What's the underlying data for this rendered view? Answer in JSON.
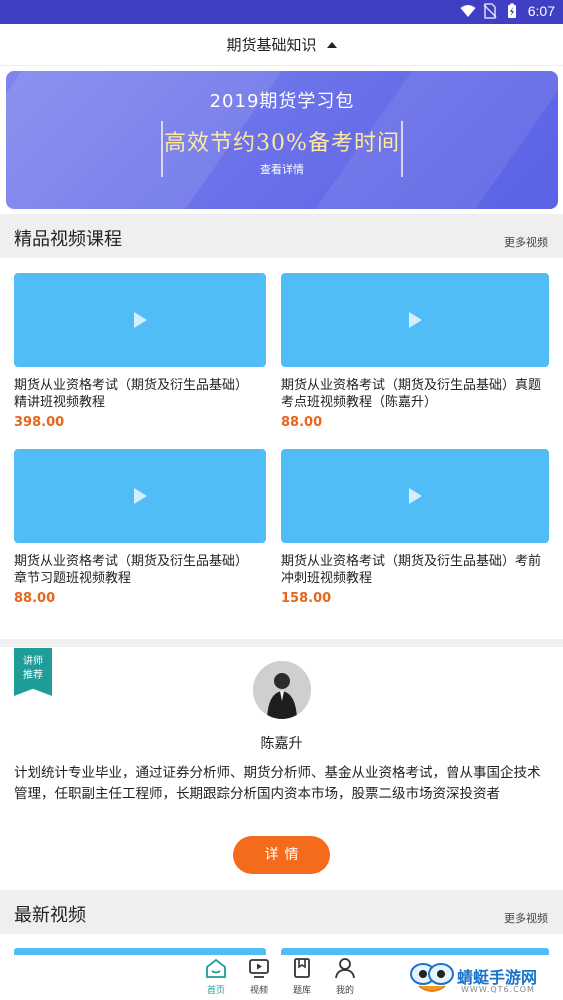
{
  "status_bar": {
    "time": "6:07",
    "icons": [
      "wifi-icon",
      "no-sim-icon",
      "battery-icon"
    ]
  },
  "header": {
    "title": "期货基础知识",
    "dropdown_icon": "caret-up-icon"
  },
  "banner": {
    "title": "2019期货学习包",
    "headline": "高效节约30%备考时间",
    "link": "查看详情"
  },
  "featured": {
    "title": "精品视频课程",
    "more": "更多视频",
    "courses": [
      {
        "title": "期货从业资格考试（期货及衍生品基础）精讲班视频教程",
        "price": "398.00"
      },
      {
        "title": "期货从业资格考试（期货及衍生品基础）真题考点班视频教程（陈嘉升）",
        "price": "88.00"
      },
      {
        "title": "期货从业资格考试（期货及衍生品基础）章节习题班视频教程",
        "price": "88.00"
      },
      {
        "title": "期货从业资格考试（期货及衍生品基础）考前冲刺班视频教程",
        "price": "158.00"
      }
    ]
  },
  "teacher": {
    "badge": "讲师推荐",
    "name": "陈嘉升",
    "description": "计划统计专业毕业，通过证券分析师、期货分析师、基金从业资格考试，曾从事国企技术管理，任职副主任工程师，长期跟踪分析国内资本市场，股票二级市场资深投资者",
    "button": "详情"
  },
  "latest": {
    "title": "最新视频",
    "more": "更多视频"
  },
  "tabs": [
    {
      "label": "首页",
      "icon": "home-icon",
      "active": true
    },
    {
      "label": "视频",
      "icon": "video-icon",
      "active": false
    },
    {
      "label": "题库",
      "icon": "question-bank-icon",
      "active": false
    },
    {
      "label": "我的",
      "icon": "profile-icon",
      "active": false
    }
  ],
  "watermark": {
    "name": "蜻蜓手游网",
    "url": "WWW.QT6.COM"
  },
  "colors": {
    "accent": "#1f9d99",
    "price": "#e8651a",
    "button": "#f56b1e",
    "thumb": "#50bdf7",
    "status_bar": "#3f3fc4"
  }
}
